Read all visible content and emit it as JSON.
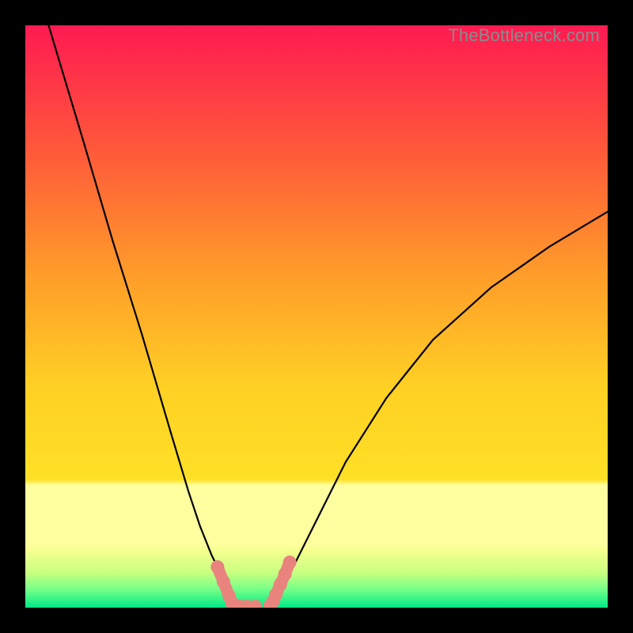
{
  "watermark": "TheBottleneck.com",
  "colors": {
    "frame": "#000000",
    "curve": "#000000",
    "marker": "#e8847d",
    "gradient_top": "#ff1a52",
    "gradient_mid1": "#ff9a2a",
    "gradient_mid2": "#ffe026",
    "gradient_band": "#ffffa0",
    "gradient_bottom": "#00ff88"
  },
  "chart_data": {
    "type": "line",
    "title": "",
    "xlabel": "",
    "ylabel": "",
    "xlim": [
      0,
      100
    ],
    "ylim": [
      0,
      100
    ],
    "series": [
      {
        "name": "left-curve",
        "x": [
          4,
          10,
          15,
          20,
          25,
          28,
          30,
          32,
          34,
          35.5,
          36.5
        ],
        "y": [
          100,
          80,
          63,
          47,
          30,
          20,
          14,
          9,
          5,
          2,
          0
        ]
      },
      {
        "name": "right-curve",
        "x": [
          42.5,
          44,
          46,
          50,
          55,
          62,
          70,
          80,
          90,
          100
        ],
        "y": [
          0,
          3,
          7,
          15,
          25,
          36,
          46,
          55,
          62,
          68
        ]
      }
    ],
    "markers": [
      {
        "name": "left-foot",
        "x": [
          33.0,
          34.0,
          35.0,
          35.5,
          36.5,
          38.0,
          39.5
        ],
        "y": [
          7.0,
          4.5,
          2.0,
          0.8,
          0.3,
          0.2,
          0.2
        ]
      },
      {
        "name": "right-foot",
        "x": [
          42.0,
          42.5,
          43.0,
          43.8,
          44.6,
          45.4
        ],
        "y": [
          0.3,
          1.0,
          2.2,
          4.0,
          5.8,
          7.8
        ]
      }
    ],
    "legend": [],
    "annotations": []
  }
}
